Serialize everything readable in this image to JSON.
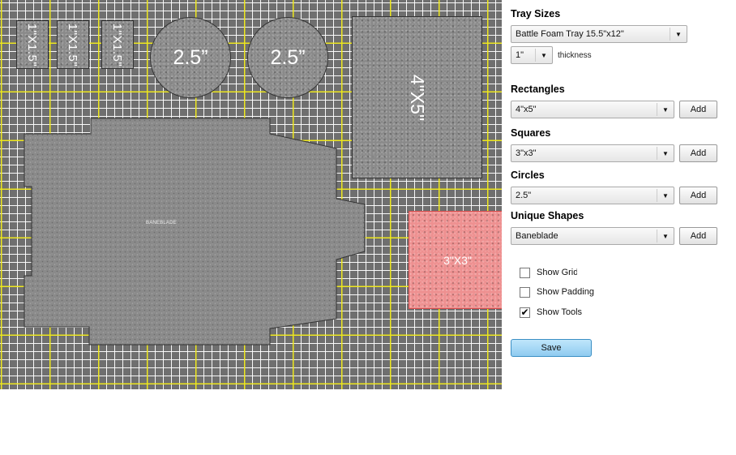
{
  "tray": {
    "small_rects": [
      "1\"X1.5\"",
      "1\"X1.5\"",
      "1\"X1.5\""
    ],
    "circles": [
      "2.5”",
      "2.5”"
    ],
    "big_rect": "4\"X5\"",
    "selected_square": "3\"X3\"",
    "unique_label": "BANEBLADE",
    "colors": {
      "grid_major": "#eee814",
      "grid_minor": "#ffffff",
      "foam": "#8a8a8a",
      "selected": "#ee9090"
    }
  },
  "panel": {
    "tray_sizes": {
      "heading": "Tray Sizes",
      "value": "Battle Foam Tray 15.5\"x12\""
    },
    "thickness": {
      "value": "1\"",
      "label": "thickness"
    },
    "rectangles": {
      "heading": "Rectangles",
      "value": "4\"x5\"",
      "add": "Add"
    },
    "squares": {
      "heading": "Squares",
      "value": "3\"x3\"",
      "add": "Add"
    },
    "circles": {
      "heading": "Circles",
      "value": "2.5\"",
      "add": "Add"
    },
    "unique": {
      "heading": "Unique Shapes",
      "value": "Baneblade",
      "add": "Add"
    },
    "options": [
      {
        "label": "Show Grid",
        "checked": false
      },
      {
        "label": "Show Padding",
        "checked": false
      },
      {
        "label": "Show Tools",
        "checked": true
      }
    ],
    "save": "Save"
  }
}
